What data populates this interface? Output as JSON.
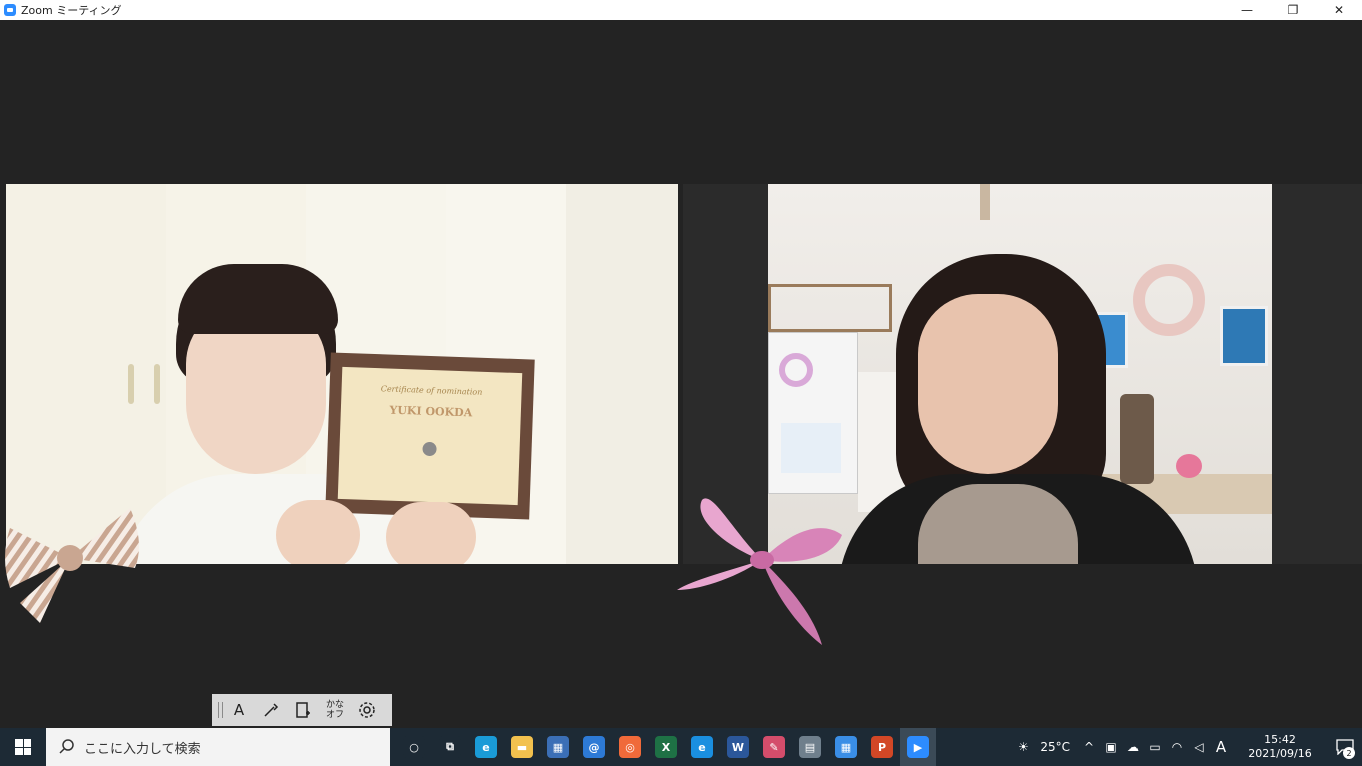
{
  "window": {
    "title": "Zoom ミーティング",
    "controls": {
      "minimize": "—",
      "restore": "❐",
      "close": "✕"
    }
  },
  "video": {
    "left": {
      "certificate_title": "Certificate of nomination",
      "certificate_name": "YUKI OOKDA"
    }
  },
  "ime_toolbar": {
    "mode": "A",
    "kana_line1": "かな",
    "kana_line2": "オフ"
  },
  "taskbar": {
    "search_placeholder": "ここに入力して検索",
    "apps": [
      {
        "name": "cortana-icon",
        "glyph": "○",
        "color": "#1d2a35"
      },
      {
        "name": "task-view-icon",
        "glyph": "⧉",
        "color": "#1d2a35"
      },
      {
        "name": "edge-icon",
        "glyph": "e",
        "color": "#1a9bd7"
      },
      {
        "name": "file-explorer-icon",
        "glyph": "▬",
        "color": "#f2c14e"
      },
      {
        "name": "store-icon",
        "glyph": "▦",
        "color": "#3b6fb6"
      },
      {
        "name": "mail-icon",
        "glyph": "@",
        "color": "#2d7ad6"
      },
      {
        "name": "app-orange-icon",
        "glyph": "◎",
        "color": "#f06a3a"
      },
      {
        "name": "excel-icon",
        "glyph": "X",
        "color": "#1e7145"
      },
      {
        "name": "ie-icon",
        "glyph": "e",
        "color": "#1a8fe0"
      },
      {
        "name": "word-icon",
        "glyph": "W",
        "color": "#2b579a"
      },
      {
        "name": "paint-icon",
        "glyph": "✎",
        "color": "#d44d6b"
      },
      {
        "name": "calculator-icon",
        "glyph": "▤",
        "color": "#6f7f8c"
      },
      {
        "name": "calendar-icon",
        "glyph": "▦",
        "color": "#3a8ee6"
      },
      {
        "name": "powerpoint-icon",
        "glyph": "P",
        "color": "#d24726"
      },
      {
        "name": "zoom-icon",
        "glyph": "▶",
        "color": "#2d8cff",
        "active": true
      }
    ],
    "tray": {
      "temperature": "25°C",
      "ime_mode": "A",
      "time": "15:42",
      "date": "2021/09/16",
      "notification_count": "2"
    }
  }
}
